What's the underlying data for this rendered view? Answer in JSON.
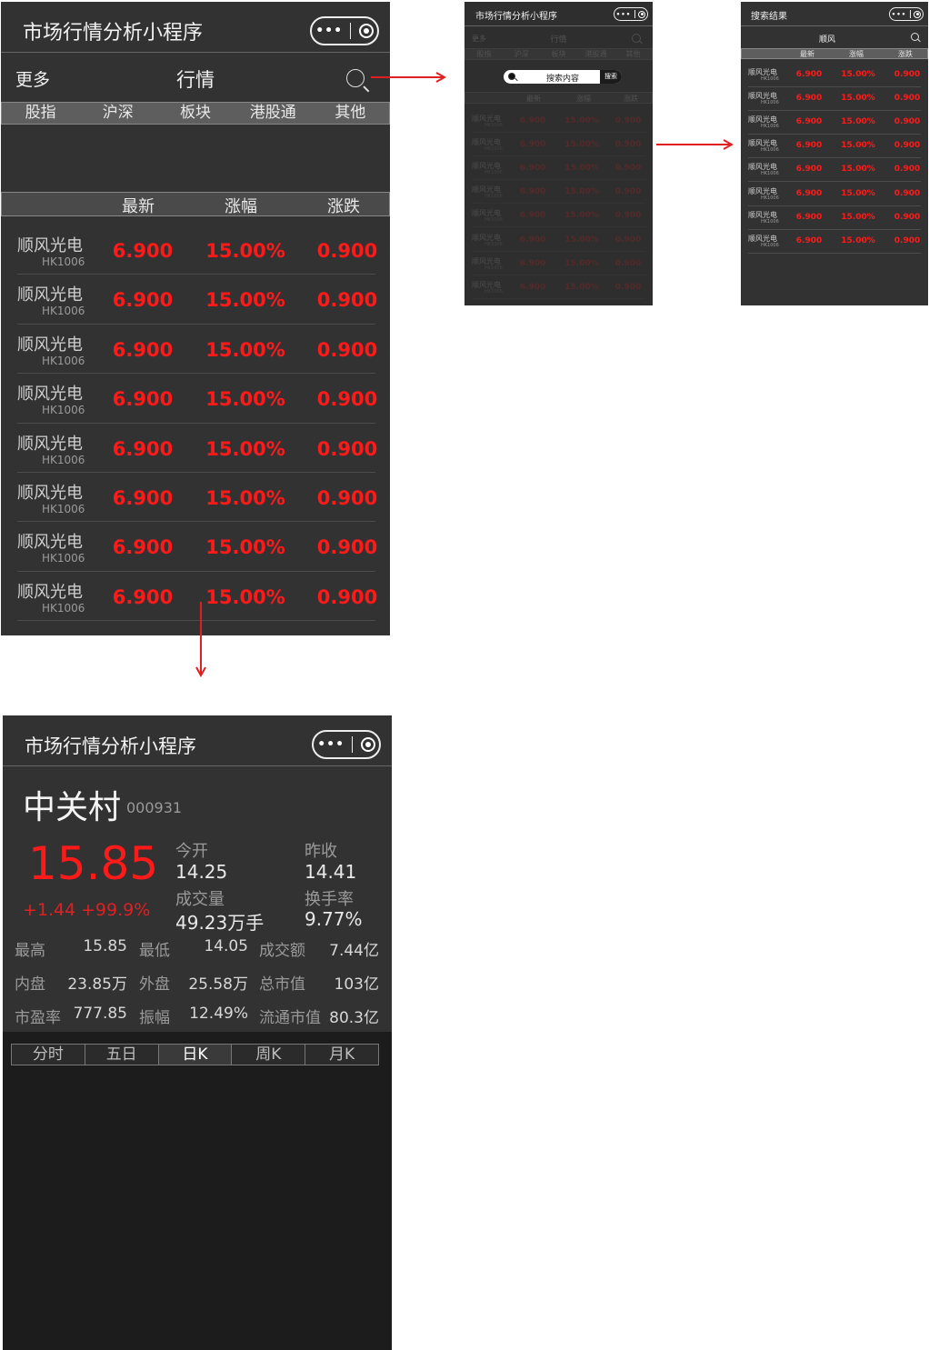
{
  "app_title": "市场行情分析小程序",
  "list_screen": {
    "more": "更多",
    "title": "行情",
    "tabs": [
      "股指",
      "沪深",
      "板块",
      "港股通",
      "其他"
    ],
    "columns": [
      "最新",
      "涨幅",
      "涨跌"
    ],
    "rows": [
      {
        "name": "顺风光电",
        "code": "HK1006",
        "latest": "6.900",
        "change_pct": "15.00%",
        "change": "0.900"
      },
      {
        "name": "顺风光电",
        "code": "HK1006",
        "latest": "6.900",
        "change_pct": "15.00%",
        "change": "0.900"
      },
      {
        "name": "顺风光电",
        "code": "HK1006",
        "latest": "6.900",
        "change_pct": "15.00%",
        "change": "0.900"
      },
      {
        "name": "顺风光电",
        "code": "HK1006",
        "latest": "6.900",
        "change_pct": "15.00%",
        "change": "0.900"
      },
      {
        "name": "顺风光电",
        "code": "HK1006",
        "latest": "6.900",
        "change_pct": "15.00%",
        "change": "0.900"
      },
      {
        "name": "顺风光电",
        "code": "HK1006",
        "latest": "6.900",
        "change_pct": "15.00%",
        "change": "0.900"
      },
      {
        "name": "顺风光电",
        "code": "HK1006",
        "latest": "6.900",
        "change_pct": "15.00%",
        "change": "0.900"
      },
      {
        "name": "顺风光电",
        "code": "HK1006",
        "latest": "6.900",
        "change_pct": "15.00%",
        "change": "0.900"
      }
    ]
  },
  "search_overlay": {
    "placeholder": "搜索内容",
    "button": "搜索"
  },
  "search_result": {
    "title": "搜索结果",
    "query": "顺风"
  },
  "detail": {
    "name": "中关村",
    "code": "000931",
    "price": "15.85",
    "change": "+1.44",
    "change_pct": "+99.9%",
    "open_label": "今开",
    "open": "14.25",
    "prev_close_label": "昨收",
    "prev_close": "14.41",
    "volume_label": "成交量",
    "volume": "49.23万手",
    "turnover_label": "换手率",
    "turnover": "9.77%",
    "grid": [
      {
        "l1": "最高",
        "v1": "15.85",
        "l2": "最低",
        "v2": "14.05",
        "l3": "成交额",
        "v3": "7.44亿"
      },
      {
        "l1": "内盘",
        "v1": "23.85万",
        "l2": "外盘",
        "v2": "25.58万",
        "l3": "总市值",
        "v3": "103亿"
      },
      {
        "l1": "市盈率",
        "v1": "777.85",
        "l2": "振幅",
        "v2": "12.49%",
        "l3": "流通市值",
        "v3": "80.3亿"
      }
    ],
    "k_tabs": [
      "分时",
      "五日",
      "日K",
      "周K",
      "月K"
    ],
    "k_active": "日K"
  },
  "colors": {
    "up": "#ff1a1a",
    "bg": "#323232",
    "arrow": "#e02020"
  },
  "icons": [
    "more-dots-icon",
    "close-circle-icon",
    "search-icon"
  ]
}
